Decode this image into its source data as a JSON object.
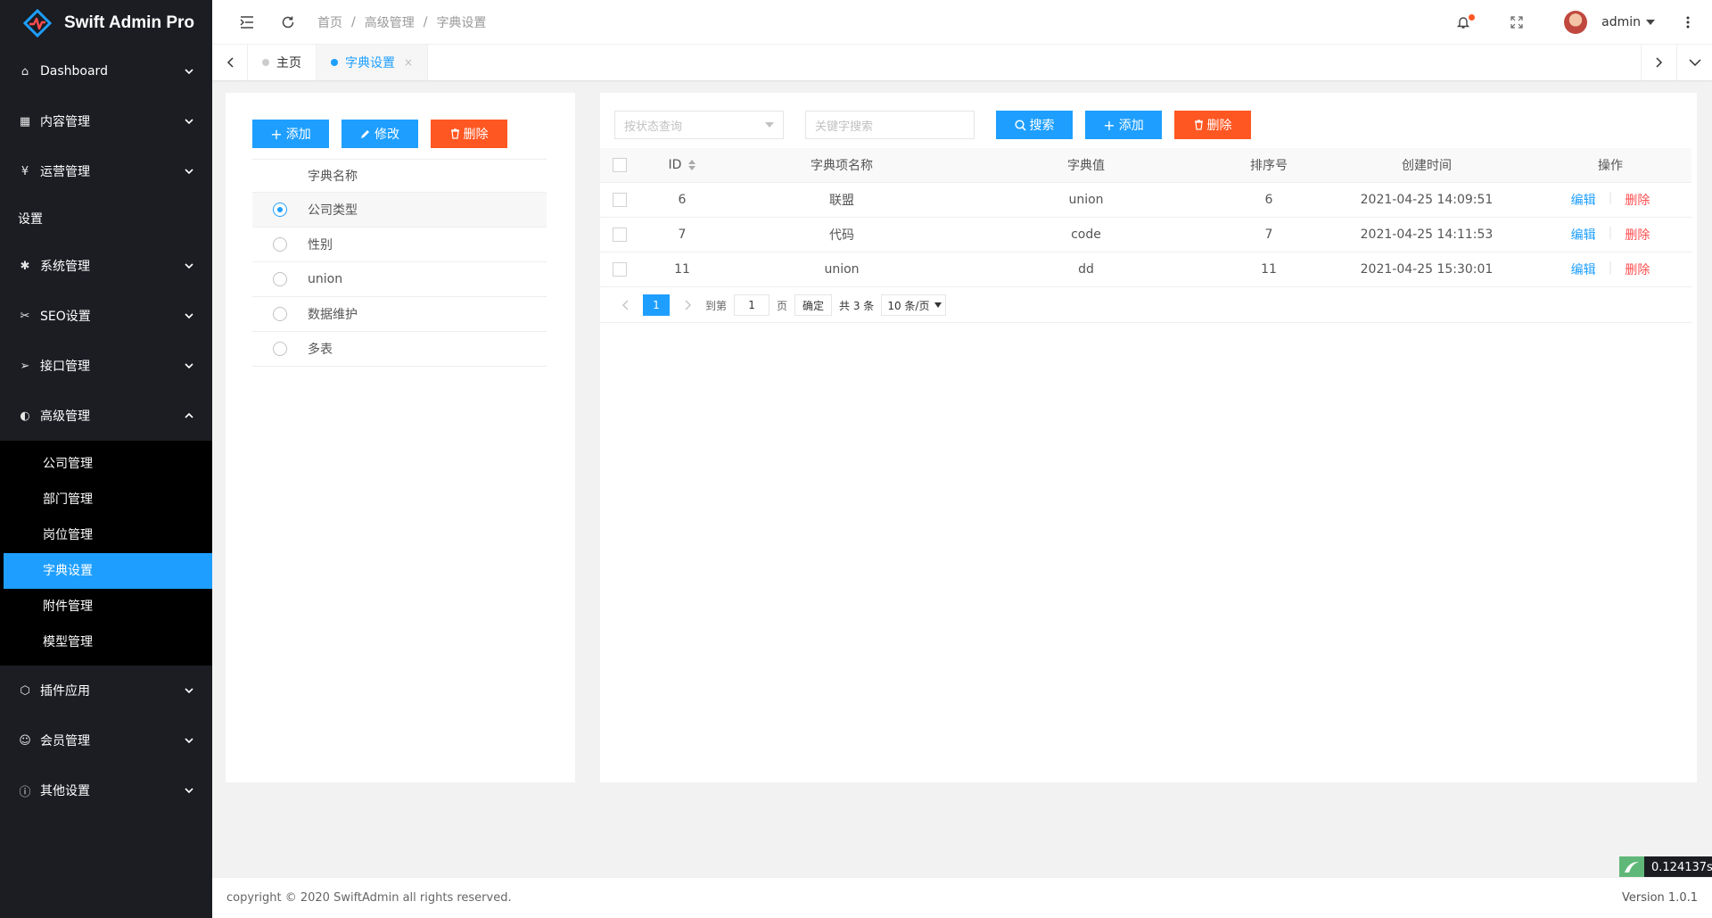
{
  "app": {
    "title": "Swift Admin Pro"
  },
  "sidebar": {
    "menu1": [
      {
        "label": "Dashboard",
        "icon": "home-icon"
      },
      {
        "label": "内容管理",
        "icon": "grid-icon"
      },
      {
        "label": "运营管理",
        "icon": "yen-icon"
      }
    ],
    "section": "设置",
    "menu2": [
      {
        "label": "系统管理",
        "icon": "gear-icon"
      },
      {
        "label": "SEO设置",
        "icon": "tools-icon"
      },
      {
        "label": "接口管理",
        "icon": "send-icon"
      },
      {
        "label": "高级管理",
        "icon": "circle-gear-icon",
        "expanded": true
      }
    ],
    "submenu": [
      {
        "label": "公司管理"
      },
      {
        "label": "部门管理"
      },
      {
        "label": "岗位管理"
      },
      {
        "label": "字典设置",
        "active": true
      },
      {
        "label": "附件管理"
      },
      {
        "label": "模型管理"
      }
    ],
    "menu3": [
      {
        "label": "插件应用",
        "icon": "cube-icon"
      },
      {
        "label": "会员管理",
        "icon": "user-icon"
      },
      {
        "label": "其他设置",
        "icon": "info-icon"
      }
    ],
    "active_color": "#1e9fff"
  },
  "header": {
    "breadcrumb": [
      "首页",
      "高级管理",
      "字典设置"
    ],
    "breadcrumb_sep": "/",
    "user": "admin"
  },
  "tabs": [
    {
      "label": "主页",
      "active": false
    },
    {
      "label": "字典设置",
      "active": true,
      "close": "×"
    }
  ],
  "left_panel": {
    "buttons": {
      "add": "添加",
      "edit": "修改",
      "delete": "删除"
    },
    "column_header": "字典名称",
    "items": [
      {
        "label": "公司类型",
        "checked": true
      },
      {
        "label": "性别",
        "checked": false
      },
      {
        "label": "union",
        "checked": false
      },
      {
        "label": "数据维护",
        "checked": false
      },
      {
        "label": "多表",
        "checked": false
      }
    ]
  },
  "right_panel": {
    "status_placeholder": "按状态查询",
    "keyword_placeholder": "关键字搜索",
    "buttons": {
      "search": "搜索",
      "add": "添加",
      "delete": "删除"
    },
    "columns": {
      "id": "ID",
      "name": "字典项名称",
      "value": "字典值",
      "sort": "排序号",
      "created": "创建时间",
      "ops": "操作"
    },
    "rows": [
      {
        "id": "6",
        "name": "联盟",
        "value": "union",
        "sort": "6",
        "created": "2021-04-25 14:09:51"
      },
      {
        "id": "7",
        "name": "代码",
        "value": "code",
        "sort": "7",
        "created": "2021-04-25 14:11:53"
      },
      {
        "id": "11",
        "name": "union",
        "value": "dd",
        "sort": "11",
        "created": "2021-04-25 15:30:01"
      }
    ],
    "row_actions": {
      "edit": "编辑",
      "delete": "删除"
    },
    "pager": {
      "current": "1",
      "goto_label": "到第",
      "goto_value": "1",
      "page_unit": "页",
      "confirm": "确定",
      "total": "共 3 条",
      "page_size": "10 条/页"
    }
  },
  "footer": {
    "copyright": "copyright © 2020 SwiftAdmin all rights reserved.",
    "version": "Version 1.0.1"
  },
  "timer": "0.124137s",
  "colors": {
    "primary": "#1e9fff",
    "danger": "#ff5722",
    "sidebar_bg": "#1b1d23"
  }
}
